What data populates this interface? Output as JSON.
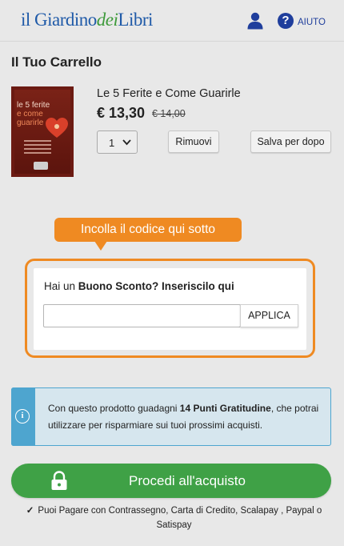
{
  "header": {
    "logo_part1": "il Giardino",
    "logo_part2": "dei",
    "logo_part3": "Libri",
    "help_label": "AIUTO",
    "user_icon": "user-icon",
    "help_icon": "question-circle-icon"
  },
  "cart": {
    "title": "Il Tuo Carrello",
    "item": {
      "title": "Le 5 Ferite e Come Guarirle",
      "price": "€ 13,30",
      "old_price": "€ 14,00",
      "quantity": "1",
      "cover": {
        "line1": "le 5 ferite",
        "line2": "e come",
        "line3": "guarirle"
      }
    },
    "remove_label": "Rimuovi",
    "save_label": "Salva per dopo"
  },
  "coupon": {
    "tooltip": "Incolla il codice qui sotto",
    "prompt_prefix": "Hai un ",
    "prompt_bold": "Buono Sconto? Inseriscilo qui",
    "input_value": "",
    "apply_label": "APPLICA"
  },
  "info": {
    "icon": "info-icon",
    "text_prefix": "Con questo prodotto guadagni ",
    "text_bold": "14 Punti Gratitudine",
    "text_suffix": ", che potrai utilizzare per risparmiare sui tuoi prossimi acquisti."
  },
  "checkout": {
    "label": "Procedi all'acquisto",
    "icon": "lock-icon"
  },
  "payment_note": "Puoi Pagare con Contrassegno, Carta di Credito, Scalapay , Paypal o Satispay",
  "colors": {
    "accent_orange": "#ef8a22",
    "checkout_green": "#3fa146",
    "info_blue": "#4ea5cf",
    "brand_blue": "#1f3e9c"
  }
}
